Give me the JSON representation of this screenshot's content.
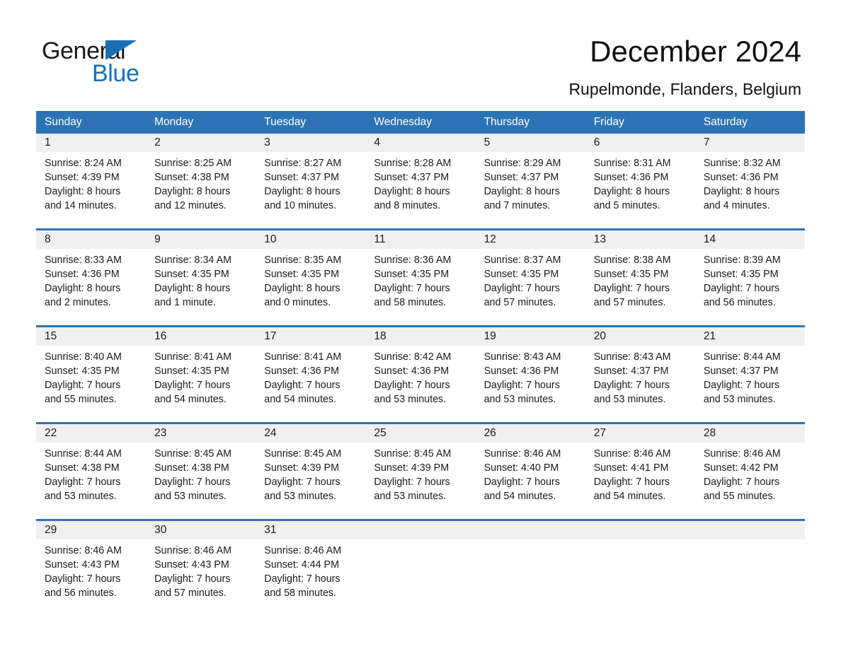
{
  "brand": {
    "name_part1": "General",
    "name_part2": "Blue",
    "accent_color": "#1a6fb4",
    "triangle_icon": "triangle-icon"
  },
  "header": {
    "title": "December 2024",
    "location": "Rupelmonde, Flanders, Belgium"
  },
  "calendar": {
    "header_bg": "#2d74b6",
    "date_band_bg": "#f0f0f0",
    "weekdays": [
      "Sunday",
      "Monday",
      "Tuesday",
      "Wednesday",
      "Thursday",
      "Friday",
      "Saturday"
    ],
    "weeks": [
      [
        {
          "day": "1",
          "sunrise": "Sunrise: 8:24 AM",
          "sunset": "Sunset: 4:39 PM",
          "daylight_line1": "Daylight: 8 hours",
          "daylight_line2": "and 14 minutes."
        },
        {
          "day": "2",
          "sunrise": "Sunrise: 8:25 AM",
          "sunset": "Sunset: 4:38 PM",
          "daylight_line1": "Daylight: 8 hours",
          "daylight_line2": "and 12 minutes."
        },
        {
          "day": "3",
          "sunrise": "Sunrise: 8:27 AM",
          "sunset": "Sunset: 4:37 PM",
          "daylight_line1": "Daylight: 8 hours",
          "daylight_line2": "and 10 minutes."
        },
        {
          "day": "4",
          "sunrise": "Sunrise: 8:28 AM",
          "sunset": "Sunset: 4:37 PM",
          "daylight_line1": "Daylight: 8 hours",
          "daylight_line2": "and 8 minutes."
        },
        {
          "day": "5",
          "sunrise": "Sunrise: 8:29 AM",
          "sunset": "Sunset: 4:37 PM",
          "daylight_line1": "Daylight: 8 hours",
          "daylight_line2": "and 7 minutes."
        },
        {
          "day": "6",
          "sunrise": "Sunrise: 8:31 AM",
          "sunset": "Sunset: 4:36 PM",
          "daylight_line1": "Daylight: 8 hours",
          "daylight_line2": "and 5 minutes."
        },
        {
          "day": "7",
          "sunrise": "Sunrise: 8:32 AM",
          "sunset": "Sunset: 4:36 PM",
          "daylight_line1": "Daylight: 8 hours",
          "daylight_line2": "and 4 minutes."
        }
      ],
      [
        {
          "day": "8",
          "sunrise": "Sunrise: 8:33 AM",
          "sunset": "Sunset: 4:36 PM",
          "daylight_line1": "Daylight: 8 hours",
          "daylight_line2": "and 2 minutes."
        },
        {
          "day": "9",
          "sunrise": "Sunrise: 8:34 AM",
          "sunset": "Sunset: 4:35 PM",
          "daylight_line1": "Daylight: 8 hours",
          "daylight_line2": "and 1 minute."
        },
        {
          "day": "10",
          "sunrise": "Sunrise: 8:35 AM",
          "sunset": "Sunset: 4:35 PM",
          "daylight_line1": "Daylight: 8 hours",
          "daylight_line2": "and 0 minutes."
        },
        {
          "day": "11",
          "sunrise": "Sunrise: 8:36 AM",
          "sunset": "Sunset: 4:35 PM",
          "daylight_line1": "Daylight: 7 hours",
          "daylight_line2": "and 58 minutes."
        },
        {
          "day": "12",
          "sunrise": "Sunrise: 8:37 AM",
          "sunset": "Sunset: 4:35 PM",
          "daylight_line1": "Daylight: 7 hours",
          "daylight_line2": "and 57 minutes."
        },
        {
          "day": "13",
          "sunrise": "Sunrise: 8:38 AM",
          "sunset": "Sunset: 4:35 PM",
          "daylight_line1": "Daylight: 7 hours",
          "daylight_line2": "and 57 minutes."
        },
        {
          "day": "14",
          "sunrise": "Sunrise: 8:39 AM",
          "sunset": "Sunset: 4:35 PM",
          "daylight_line1": "Daylight: 7 hours",
          "daylight_line2": "and 56 minutes."
        }
      ],
      [
        {
          "day": "15",
          "sunrise": "Sunrise: 8:40 AM",
          "sunset": "Sunset: 4:35 PM",
          "daylight_line1": "Daylight: 7 hours",
          "daylight_line2": "and 55 minutes."
        },
        {
          "day": "16",
          "sunrise": "Sunrise: 8:41 AM",
          "sunset": "Sunset: 4:35 PM",
          "daylight_line1": "Daylight: 7 hours",
          "daylight_line2": "and 54 minutes."
        },
        {
          "day": "17",
          "sunrise": "Sunrise: 8:41 AM",
          "sunset": "Sunset: 4:36 PM",
          "daylight_line1": "Daylight: 7 hours",
          "daylight_line2": "and 54 minutes."
        },
        {
          "day": "18",
          "sunrise": "Sunrise: 8:42 AM",
          "sunset": "Sunset: 4:36 PM",
          "daylight_line1": "Daylight: 7 hours",
          "daylight_line2": "and 53 minutes."
        },
        {
          "day": "19",
          "sunrise": "Sunrise: 8:43 AM",
          "sunset": "Sunset: 4:36 PM",
          "daylight_line1": "Daylight: 7 hours",
          "daylight_line2": "and 53 minutes."
        },
        {
          "day": "20",
          "sunrise": "Sunrise: 8:43 AM",
          "sunset": "Sunset: 4:37 PM",
          "daylight_line1": "Daylight: 7 hours",
          "daylight_line2": "and 53 minutes."
        },
        {
          "day": "21",
          "sunrise": "Sunrise: 8:44 AM",
          "sunset": "Sunset: 4:37 PM",
          "daylight_line1": "Daylight: 7 hours",
          "daylight_line2": "and 53 minutes."
        }
      ],
      [
        {
          "day": "22",
          "sunrise": "Sunrise: 8:44 AM",
          "sunset": "Sunset: 4:38 PM",
          "daylight_line1": "Daylight: 7 hours",
          "daylight_line2": "and 53 minutes."
        },
        {
          "day": "23",
          "sunrise": "Sunrise: 8:45 AM",
          "sunset": "Sunset: 4:38 PM",
          "daylight_line1": "Daylight: 7 hours",
          "daylight_line2": "and 53 minutes."
        },
        {
          "day": "24",
          "sunrise": "Sunrise: 8:45 AM",
          "sunset": "Sunset: 4:39 PM",
          "daylight_line1": "Daylight: 7 hours",
          "daylight_line2": "and 53 minutes."
        },
        {
          "day": "25",
          "sunrise": "Sunrise: 8:45 AM",
          "sunset": "Sunset: 4:39 PM",
          "daylight_line1": "Daylight: 7 hours",
          "daylight_line2": "and 53 minutes."
        },
        {
          "day": "26",
          "sunrise": "Sunrise: 8:46 AM",
          "sunset": "Sunset: 4:40 PM",
          "daylight_line1": "Daylight: 7 hours",
          "daylight_line2": "and 54 minutes."
        },
        {
          "day": "27",
          "sunrise": "Sunrise: 8:46 AM",
          "sunset": "Sunset: 4:41 PM",
          "daylight_line1": "Daylight: 7 hours",
          "daylight_line2": "and 54 minutes."
        },
        {
          "day": "28",
          "sunrise": "Sunrise: 8:46 AM",
          "sunset": "Sunset: 4:42 PM",
          "daylight_line1": "Daylight: 7 hours",
          "daylight_line2": "and 55 minutes."
        }
      ],
      [
        {
          "day": "29",
          "sunrise": "Sunrise: 8:46 AM",
          "sunset": "Sunset: 4:43 PM",
          "daylight_line1": "Daylight: 7 hours",
          "daylight_line2": "and 56 minutes."
        },
        {
          "day": "30",
          "sunrise": "Sunrise: 8:46 AM",
          "sunset": "Sunset: 4:43 PM",
          "daylight_line1": "Daylight: 7 hours",
          "daylight_line2": "and 57 minutes."
        },
        {
          "day": "31",
          "sunrise": "Sunrise: 8:46 AM",
          "sunset": "Sunset: 4:44 PM",
          "daylight_line1": "Daylight: 7 hours",
          "daylight_line2": "and 58 minutes."
        },
        {
          "day": "",
          "sunrise": "",
          "sunset": "",
          "daylight_line1": "",
          "daylight_line2": ""
        },
        {
          "day": "",
          "sunrise": "",
          "sunset": "",
          "daylight_line1": "",
          "daylight_line2": ""
        },
        {
          "day": "",
          "sunrise": "",
          "sunset": "",
          "daylight_line1": "",
          "daylight_line2": ""
        },
        {
          "day": "",
          "sunrise": "",
          "sunset": "",
          "daylight_line1": "",
          "daylight_line2": ""
        }
      ]
    ]
  }
}
